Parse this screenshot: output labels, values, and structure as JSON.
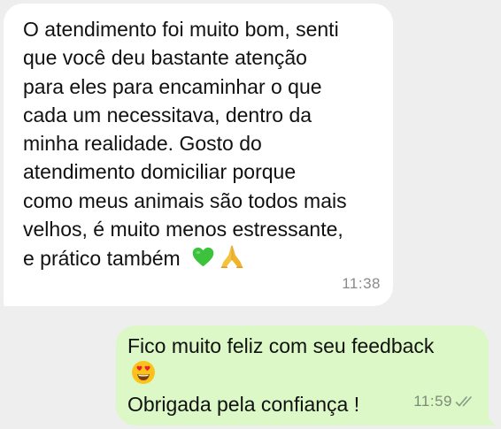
{
  "chat": {
    "incoming": {
      "text": "O atendimento foi muito bom, senti\nque você deu bastante atenção\npara eles para encaminhar o que\ncada um necessitava, dentro da\nminha realidade. Gosto do\natendimento domiciliar porque\ncomo meus animais são todos mais\nvelhos, é muito menos estressante,\ne prático também",
      "emojis": [
        "green-heart-icon",
        "folded-hands-icon"
      ],
      "time": "11:38",
      "bubble_color": "#ffffff"
    },
    "outgoing": {
      "line1": "Fico muito feliz com seu feedback",
      "emoji": "smiling-face-with-heart-eyes-icon",
      "line3": "Obrigada pela confiança !",
      "time": "11:59",
      "status_icon": "double-check-icon",
      "bubble_color": "#dcf8c6"
    },
    "background_color": "#eeeeee"
  }
}
